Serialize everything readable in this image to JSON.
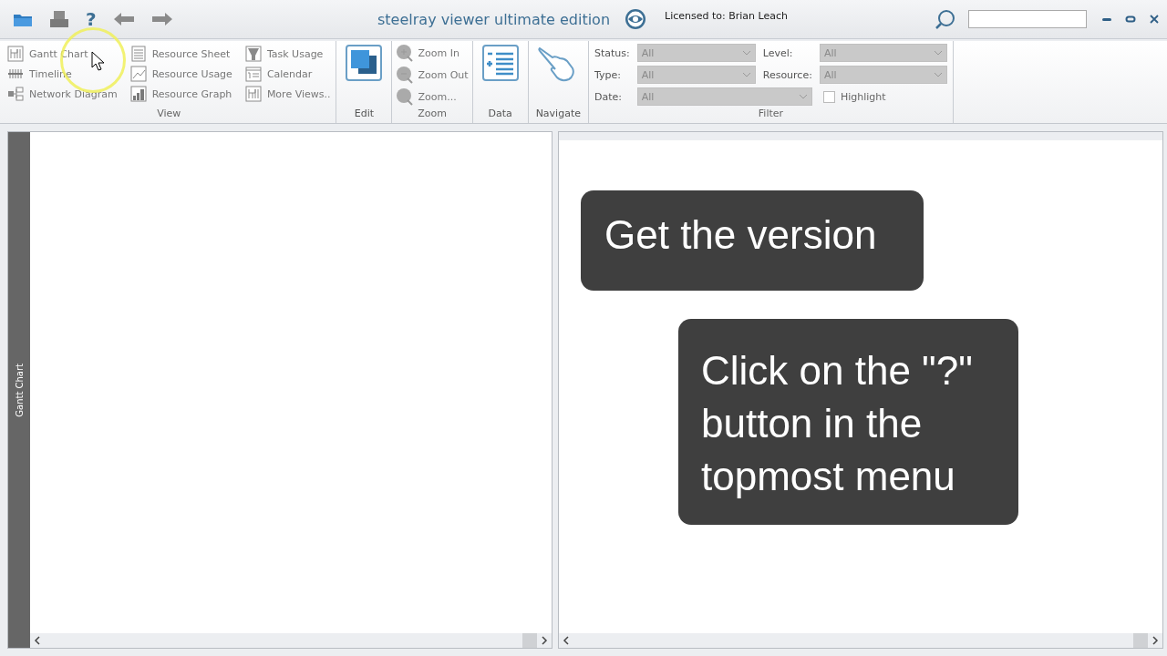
{
  "title_bar": {
    "help_glyph": "?",
    "title": "steelray viewer ultimate edition",
    "license": "Licensed to: Brian Leach"
  },
  "ribbon": {
    "view": {
      "label": "View",
      "items": [
        {
          "kind": "gantt",
          "label": "Gantt Chart"
        },
        {
          "kind": "timeline",
          "label": "Timeline"
        },
        {
          "kind": "network",
          "label": "Network Diagram"
        },
        {
          "kind": "sheet",
          "label": "Resource Sheet"
        },
        {
          "kind": "usage",
          "label": "Resource Usage"
        },
        {
          "kind": "graph",
          "label": "Resource Graph"
        },
        {
          "kind": "funnel",
          "label": "Task Usage"
        },
        {
          "kind": "calendar",
          "label": "Calendar"
        },
        {
          "kind": "gantt",
          "label": "More Views.."
        }
      ]
    },
    "edit": {
      "label": "Edit"
    },
    "zoom": {
      "label": "Zoom",
      "items": [
        {
          "kind": "plus",
          "label": "Zoom In"
        },
        {
          "kind": "minus",
          "label": "Zoom Out"
        },
        {
          "kind": "plain",
          "label": "Zoom..."
        }
      ]
    },
    "data": {
      "label": "Data"
    },
    "navigate": {
      "label": "Navigate"
    },
    "filter": {
      "label": "Filter",
      "fields": [
        {
          "label": "Status:",
          "value": "All",
          "disabled": true
        },
        {
          "label": "Level:",
          "value": "All",
          "disabled": true
        },
        {
          "label": "Type:",
          "value": "All",
          "disabled": true
        },
        {
          "label": "Resource:",
          "value": "All",
          "disabled": true
        },
        {
          "label": "Date:",
          "value": "All",
          "disabled": true
        }
      ],
      "highlight": {
        "label": "Highlight",
        "checked": false
      }
    }
  },
  "left_pane": {
    "side_tab": "Gantt Chart"
  },
  "callouts": [
    "Get the version",
    "Click on the \"?\" button in the topmost menu"
  ]
}
